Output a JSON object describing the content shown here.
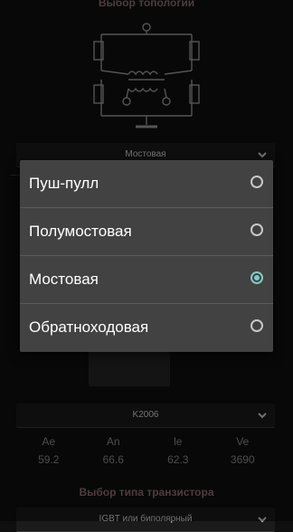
{
  "topology_title": "Выбор топологии",
  "topology_select": {
    "value": "Мостовая"
  },
  "dialog": {
    "options": [
      {
        "label": "Пуш-пулл",
        "selected": false
      },
      {
        "label": "Полумостовая",
        "selected": false
      },
      {
        "label": "Мостовая",
        "selected": true
      },
      {
        "label": "Обратноходовая",
        "selected": false
      }
    ]
  },
  "core_select": {
    "value": "K2006"
  },
  "params": [
    {
      "name": "Ae",
      "value": "59.2"
    },
    {
      "name": "An",
      "value": "66.6"
    },
    {
      "name": "le",
      "value": "62.3"
    },
    {
      "name": "Ve",
      "value": "3690"
    }
  ],
  "transistor_title": "Выбор типа транзистора",
  "transistor_select": {
    "value": "IGBT или биполярный"
  },
  "colors": {
    "accent": "#80cbc4",
    "title": "#8e6d6d",
    "dialog_bg": "#424242"
  }
}
